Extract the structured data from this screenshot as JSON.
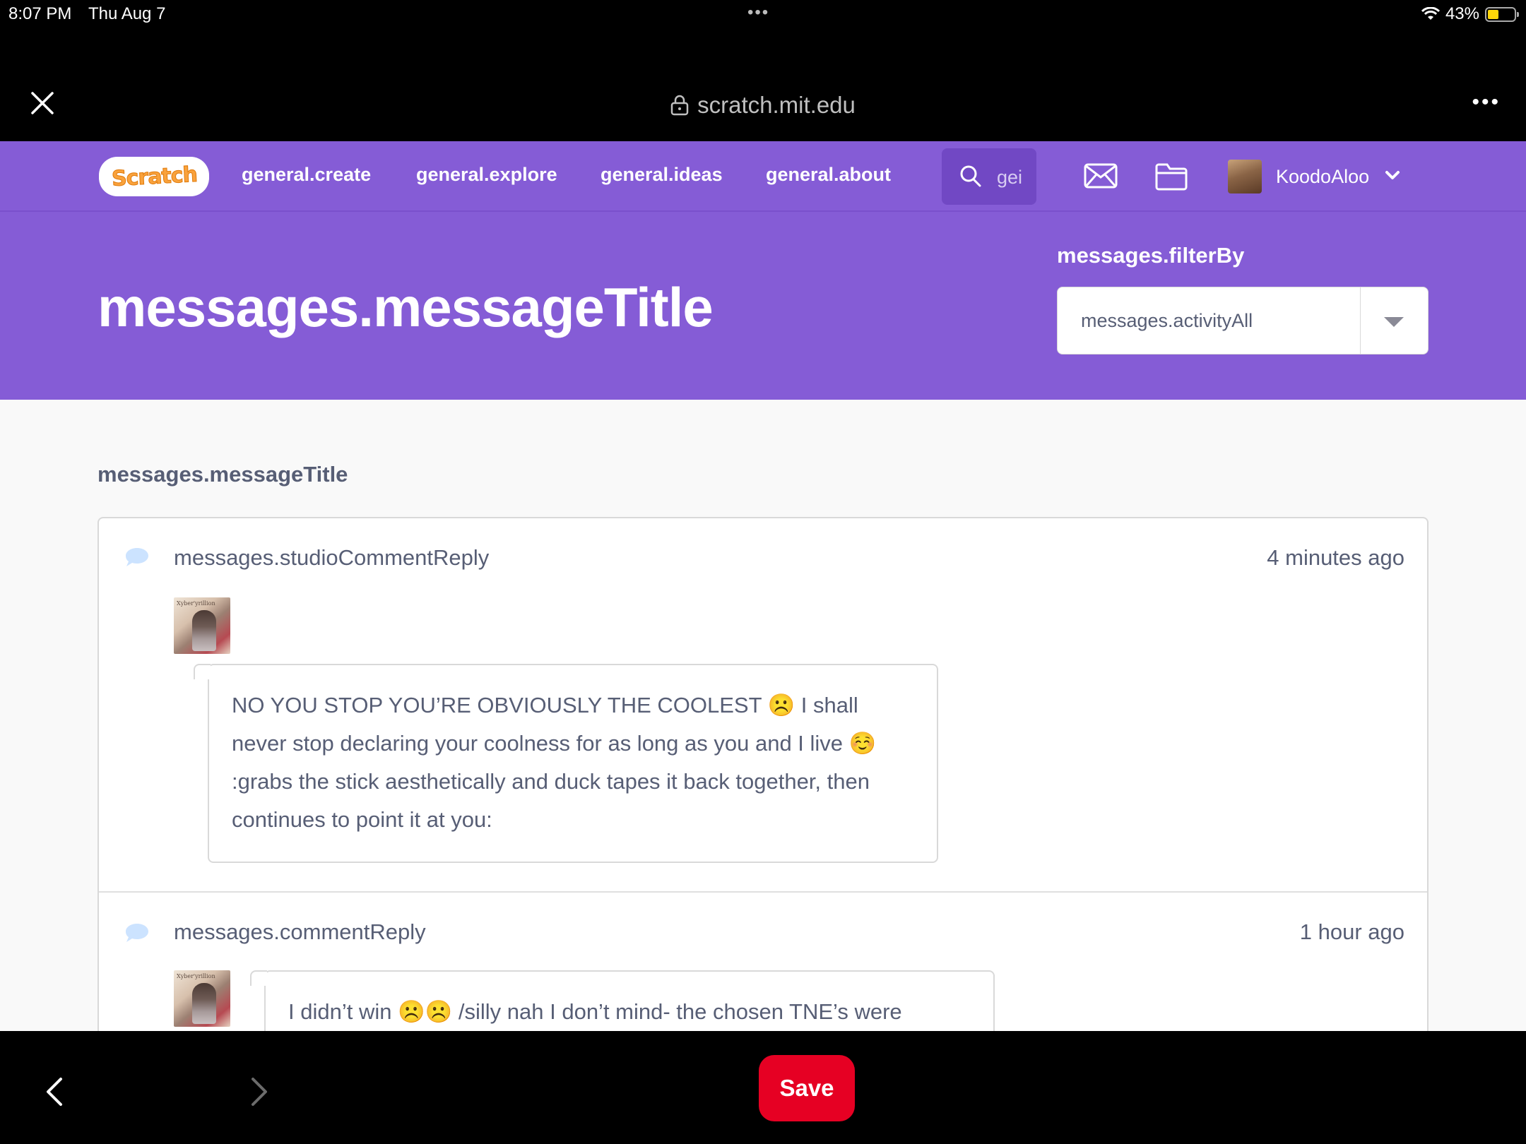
{
  "status_bar": {
    "time": "8:07 PM",
    "date": "Thu Aug 7",
    "battery": "43%",
    "battery_level": 0.43
  },
  "browser": {
    "url": "scratch.mit.edu",
    "icons": [
      "close-icon",
      "lock-icon",
      "more-icon"
    ]
  },
  "nav": {
    "logo": "Scratch",
    "links": [
      "general.create",
      "general.explore",
      "general.ideas",
      "general.about"
    ],
    "search_placeholder": "general.search",
    "search_visible": "gei",
    "username": "KoodoAloo",
    "icons": [
      "search-icon",
      "messages-icon",
      "my-stuff-icon",
      "chevron-down-icon"
    ]
  },
  "header": {
    "title": "messages.messageTitle",
    "filter_label": "messages.filterBy",
    "filter_value": "messages.activityAll"
  },
  "content": {
    "section_title": "messages.messageTitle",
    "messages": [
      {
        "type": "messages.studioCommentReply",
        "time": "4 minutes ago",
        "comment": "NO YOU STOP YOU’RE OBVIOUSLY THE COOLEST ☹️ I shall never stop declaring your coolness for as long as you and I live ☺️ :grabs the stick aesthetically and duck tapes it back together, then continues to point it at you:",
        "avatar_text": "Xyber'yrillion"
      },
      {
        "type": "messages.commentReply",
        "time": "1 hour ago",
        "comment": "I didn’t win ☹️☹️ /silly nah I don’t mind- the chosen TNE’s were",
        "avatar_text": "Xyber'yrillion"
      }
    ]
  },
  "bottom_bar": {
    "save_label": "Save",
    "save_color": "#e60023"
  },
  "colors": {
    "scratch_purple": "#855cd6",
    "text": "#575e75"
  }
}
